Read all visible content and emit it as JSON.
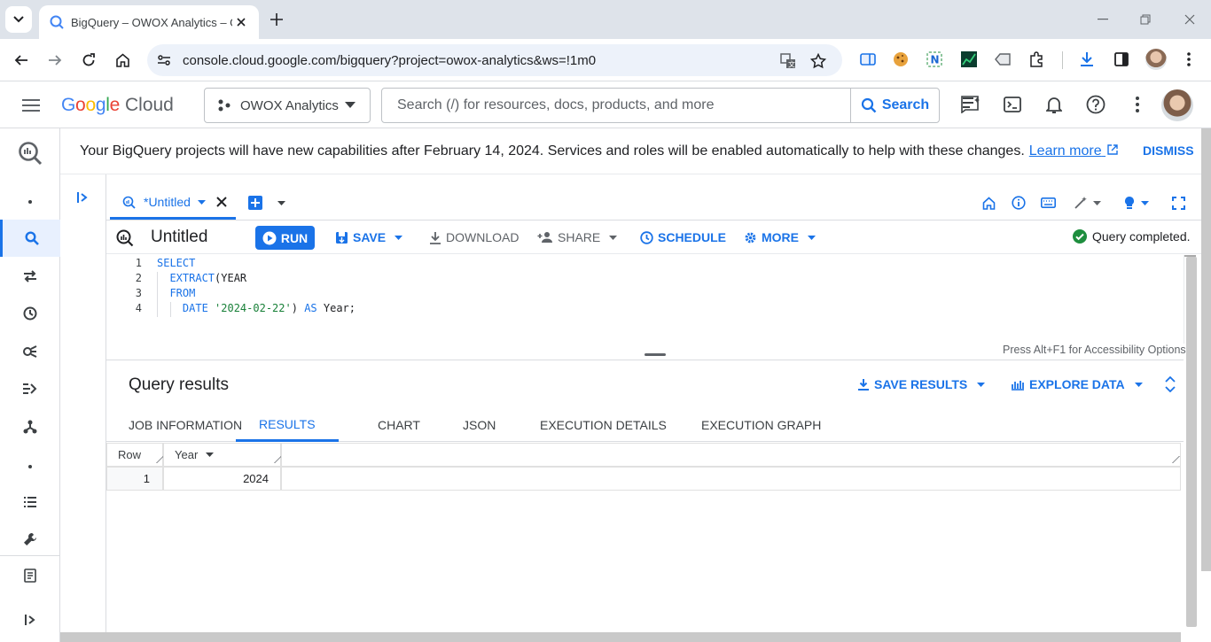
{
  "browser": {
    "tab_title": "BigQuery – OWOX Analytics – G",
    "url": "console.cloud.google.com/bigquery?project=owox-analytics&ws=!1m0"
  },
  "gcp": {
    "logo_google": "Google",
    "logo_cloud": "Cloud",
    "project": "OWOX Analytics",
    "search_placeholder": "Search (/) for resources, docs, products, and more",
    "search_button": "Search"
  },
  "banner": {
    "text": "Your BigQuery projects will have new capabilities after February 14, 2024. Services and roles will be enabled automatically to help with these changes.",
    "link": "Learn more",
    "dismiss": "DISMISS"
  },
  "editor": {
    "tab_label": "*Untitled",
    "title": "Untitled",
    "run": "RUN",
    "save": "SAVE",
    "download": "DOWNLOAD",
    "share": "SHARE",
    "schedule": "SCHEDULE",
    "more": "MORE",
    "status": "Query completed.",
    "accessibility_hint": "Press Alt+F1 for Accessibility Options.",
    "lines": [
      {
        "n": "1",
        "parts": [
          {
            "t": "SELECT",
            "c": "kw"
          }
        ]
      },
      {
        "n": "2",
        "parts": [
          {
            "t": "  EXTRACT",
            "c": "fn"
          },
          {
            "t": "(YEAR",
            "c": ""
          }
        ]
      },
      {
        "n": "3",
        "parts": [
          {
            "t": "  FROM",
            "c": "kw"
          }
        ]
      },
      {
        "n": "4",
        "parts": [
          {
            "t": "    DATE ",
            "c": "kw"
          },
          {
            "t": "'2024-02-22'",
            "c": "str"
          },
          {
            "t": ") ",
            "c": ""
          },
          {
            "t": "AS",
            "c": "kw"
          },
          {
            "t": " Year;",
            "c": ""
          }
        ]
      }
    ]
  },
  "results": {
    "title": "Query results",
    "save_results": "SAVE RESULTS",
    "explore_data": "EXPLORE DATA",
    "tabs": [
      "JOB INFORMATION",
      "RESULTS",
      "CHART",
      "JSON",
      "EXECUTION DETAILS",
      "EXECUTION GRAPH"
    ],
    "active_tab": "RESULTS",
    "columns": [
      "Row",
      "Year"
    ],
    "rows": [
      [
        "1",
        "2024"
      ]
    ]
  }
}
